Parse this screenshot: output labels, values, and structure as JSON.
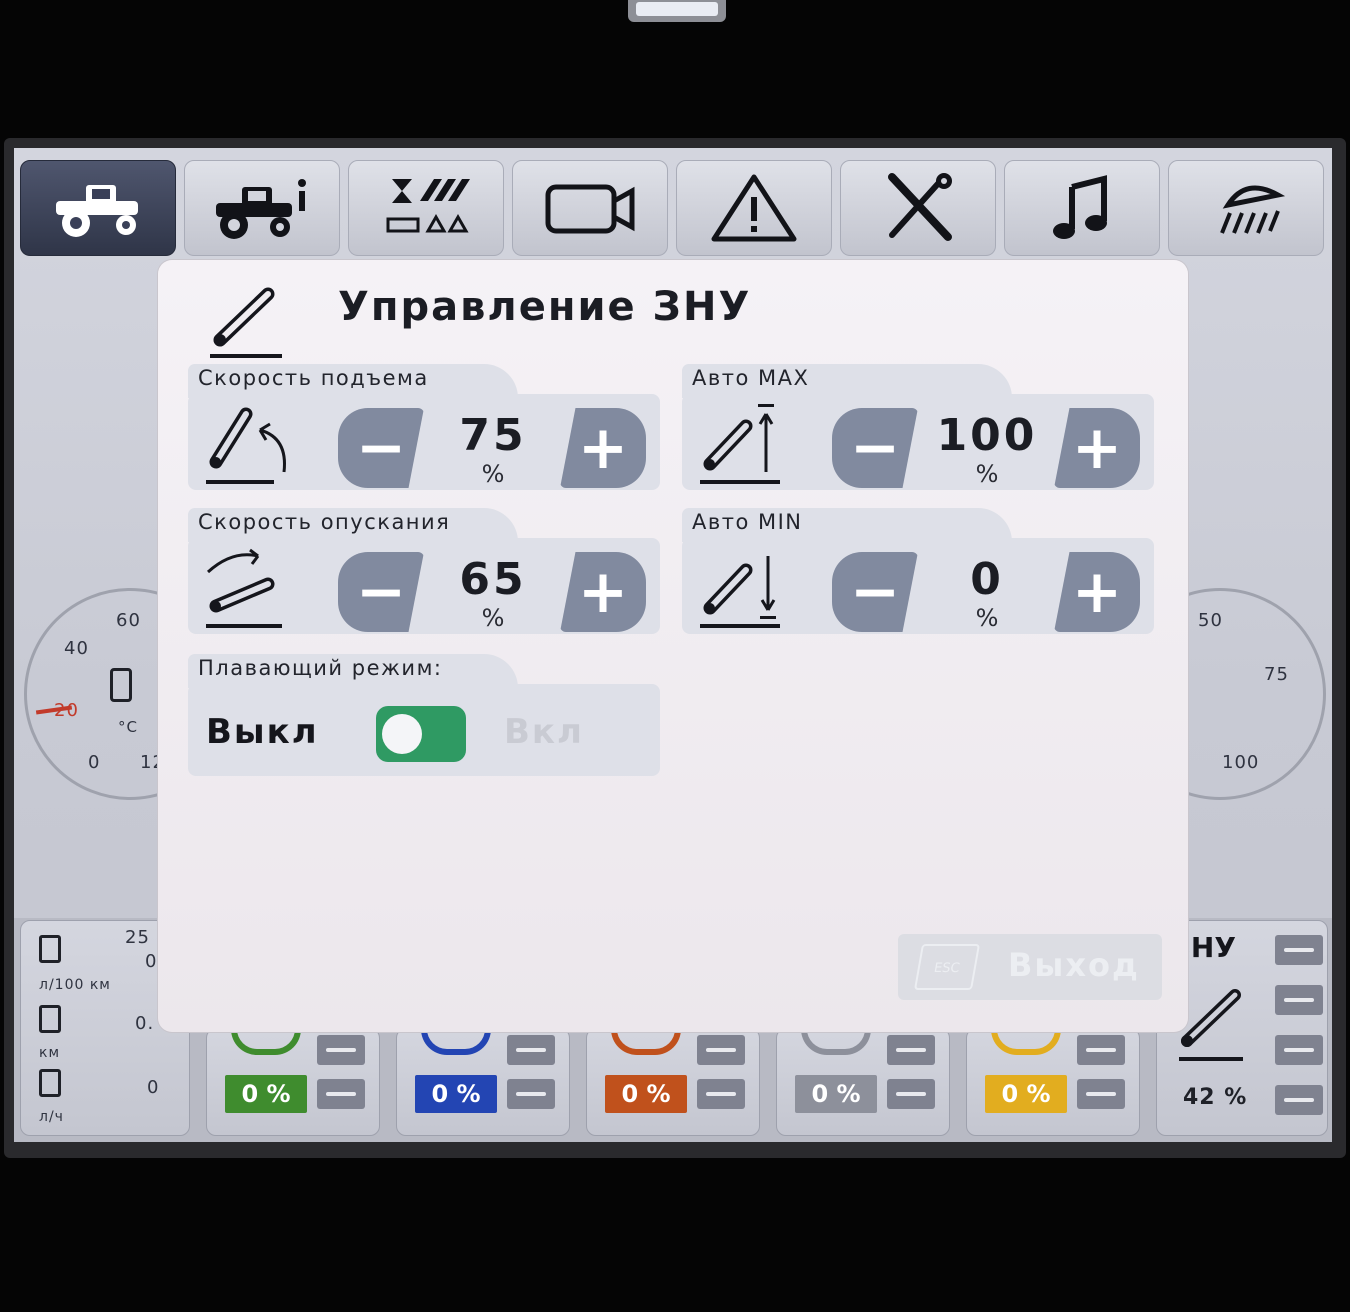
{
  "dialog": {
    "title": "Управление ЗНУ",
    "lift_speed": {
      "label": "Скорость подъема",
      "value": "75",
      "unit": "%"
    },
    "auto_max": {
      "label": "Авто MAX",
      "value": "100",
      "unit": "%"
    },
    "lower_speed": {
      "label": "Скорость опускания",
      "value": "65",
      "unit": "%"
    },
    "auto_min": {
      "label": "Авто MIN",
      "value": "0",
      "unit": "%"
    },
    "float_mode": {
      "label": "Плавающий режим:",
      "off_label": "Выкл",
      "on_label": "Вкл",
      "state": "off"
    },
    "exit": {
      "key": "ESC",
      "label": "Выход"
    },
    "minus_symbol": "−",
    "plus_symbol": "+"
  },
  "tabs": [
    {
      "icon": "tractor-icon",
      "active": true
    },
    {
      "icon": "tractor-info-icon",
      "active": false
    },
    {
      "icon": "implement-settings-icon",
      "active": false
    },
    {
      "icon": "camera-icon",
      "active": false
    },
    {
      "icon": "warning-icon",
      "active": false
    },
    {
      "icon": "tools-icon",
      "active": false
    },
    {
      "icon": "music-note-icon",
      "active": false
    },
    {
      "icon": "work-light-icon",
      "active": false
    }
  ],
  "background": {
    "left_gauge": {
      "ticks": [
        "60",
        "40",
        "20",
        "0",
        "12"
      ],
      "unit": "°C"
    },
    "right_gauge": {
      "ticks": [
        "50",
        "75",
        "100"
      ]
    },
    "fuel_panel": {
      "row1_value": "25",
      "row1_value2": "0",
      "row1_unit": "л/100 км",
      "row2_value": "0.",
      "row2_unit": "км",
      "row3_value": "0",
      "row3_unit": "л/ч"
    },
    "hydraulic_sections": [
      {
        "value": "0 %",
        "color": "#3f8c2e"
      },
      {
        "value": "0 %",
        "color": "#2345b3"
      },
      {
        "value": "0 %",
        "color": "#c0511c"
      },
      {
        "value": "0 %",
        "color": "#8d909b"
      },
      {
        "value": "0 %",
        "color": "#e2ad1f"
      }
    ],
    "rear_hitch": {
      "title": "ЗНУ",
      "value": "42 %"
    }
  },
  "colors": {
    "active_tab": "#2f3548",
    "stepper_button": "#818a9f",
    "toggle_green": "#2f9a63"
  }
}
